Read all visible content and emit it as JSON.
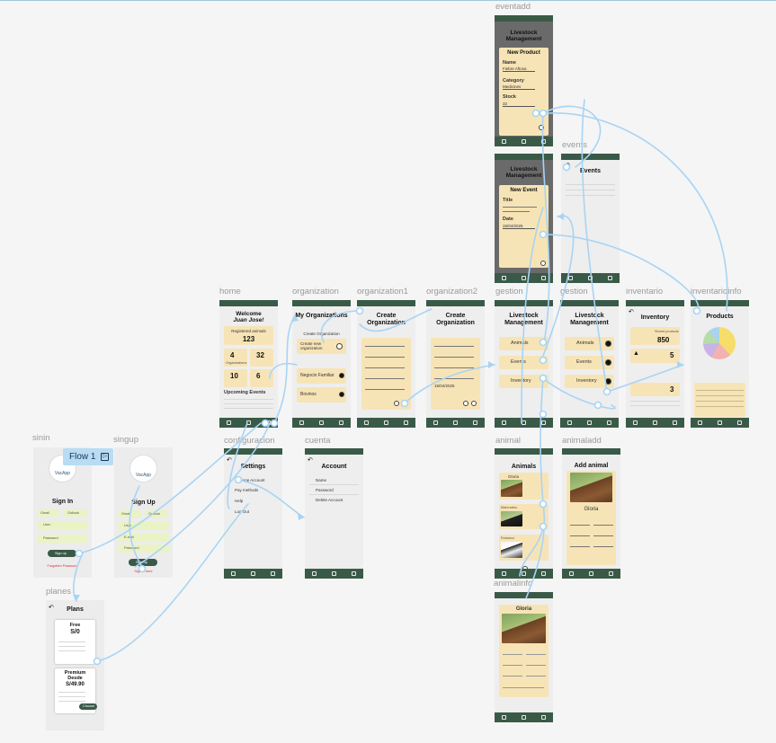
{
  "frames": {
    "eventadd": "eventadd",
    "events": "events",
    "home": "home",
    "organization": "organization",
    "organization1": "organization1",
    "organization2": "organization2",
    "gestion": "gestion",
    "gestion2": "gestion",
    "inventario": "inventario",
    "inventarioinfo": "inventarioinfo",
    "configuracion": "configuracion",
    "cuenta": "cuenta",
    "animal": "animal",
    "animaladd": "animaladd",
    "animalinfo": "animalinfo",
    "sinin": "sinin",
    "singup": "singup",
    "planes": "planes"
  },
  "flow_tag": {
    "label": "Flow 1"
  },
  "eventadd": {
    "title": "Livestock Management",
    "card_title": "New Product",
    "name_label": "Name",
    "name_value": "Fiebre Aftosa",
    "category_label": "Category",
    "category_value": "Medicines",
    "stock_label": "Stock",
    "stock_value": "32"
  },
  "newevent": {
    "title": "Livestock Management",
    "card_title": "New Event",
    "title_label": "Title",
    "date_label": "Date",
    "date_value": "15/04/2025"
  },
  "events": {
    "title": "Events"
  },
  "home": {
    "welcome": "Welcome",
    "user": "Juan Jose!",
    "registered_label": "Registered animals",
    "registered_value": "123",
    "stat1_value": "4",
    "stat1_label": "Organizations",
    "stat2_value": "32",
    "stat3_value": "10",
    "stat4_value": "6",
    "events_title": "Upcoming Events"
  },
  "organization": {
    "title": "My Organizations",
    "create_label": "Create Organization",
    "create_button": "Create new organization",
    "org1_name": "Negocio Familiar",
    "org2_name": "Bovinos"
  },
  "organization1": {
    "title": "Create Organization"
  },
  "organization2": {
    "title": "Create Organization",
    "date_value": "15/04/2025"
  },
  "gestion": {
    "title": "Livestock Management",
    "item1": "Animals",
    "item2": "Events",
    "item3": "Inventory"
  },
  "gestion2": {
    "title": "Livestock Management",
    "item1": "Animals",
    "item2": "Events",
    "item3": "Inventory"
  },
  "inventario": {
    "title": "Inventory",
    "card1_label": "Stored products",
    "card1_value": "850",
    "card2_value": "5",
    "card3_value": "3"
  },
  "inventarioinfo": {
    "title": "Products"
  },
  "configuracion": {
    "title": "Settings",
    "item1": "Manage Account",
    "item2": "Pay methods",
    "item3": "Help",
    "item4": "Log Out"
  },
  "cuenta": {
    "title": "Account",
    "item1": "Name",
    "item2": "Password",
    "item3": "Delete Account"
  },
  "animal": {
    "title": "Animals",
    "a1_name": "Gloria",
    "a2_name": "Matorrales",
    "a3_name": "Robasco"
  },
  "animaladd": {
    "title": "Add animal",
    "name": "Gloria"
  },
  "animalinfo": {
    "name": "Gloria"
  },
  "sinin": {
    "logo_text": "VacApp",
    "title": "Sign In",
    "google": "Gmail",
    "outlook": "Outlook",
    "user": "User",
    "password": "Password",
    "button": "Sign up",
    "link": "Forgotten Password"
  },
  "singup": {
    "logo_text": "VacApp",
    "title": "Sign Up",
    "google": "Gmail",
    "outlook": "Outlook",
    "user": "User",
    "email": "E-mail",
    "password": "Password",
    "button": "Sign up",
    "link": "Sign in here"
  },
  "planes": {
    "title": "Plans",
    "plan1_name": "Free",
    "plan1_price": "S/0",
    "plan2_name": "Premium",
    "plan2_sub": "Desde",
    "plan2_price": "S/49.90",
    "choose": "Choose"
  }
}
